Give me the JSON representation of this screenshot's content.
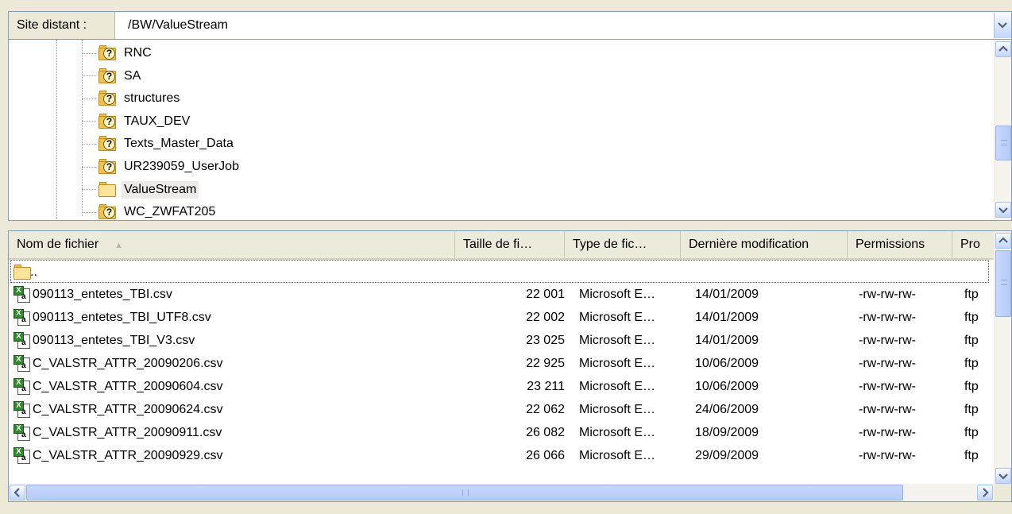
{
  "remote_site": {
    "label": "Site distant :",
    "path": "/BW/ValueStream"
  },
  "tree": {
    "items": [
      {
        "label": "RNC",
        "icon": "folder-unknown-icon",
        "selected": false
      },
      {
        "label": "SA",
        "icon": "folder-unknown-icon",
        "selected": false
      },
      {
        "label": "structures",
        "icon": "folder-unknown-icon",
        "selected": false
      },
      {
        "label": "TAUX_DEV",
        "icon": "folder-unknown-icon",
        "selected": false
      },
      {
        "label": "Texts_Master_Data",
        "icon": "folder-unknown-icon",
        "selected": false
      },
      {
        "label": "UR239059_UserJob",
        "icon": "folder-unknown-icon",
        "selected": false
      },
      {
        "label": "ValueStream",
        "icon": "folder-open-icon",
        "selected": true
      },
      {
        "label": "WC_ZWFAT205",
        "icon": "folder-unknown-icon",
        "selected": false
      }
    ]
  },
  "file_list": {
    "headers": {
      "name": "Nom de fichier",
      "sort_indicator": "▲",
      "size": "Taille de fi…",
      "type": "Type de fic…",
      "modified": "Dernière modification",
      "permissions": "Permissions",
      "owner": "Pro"
    },
    "parent_dir": "..",
    "rows": [
      {
        "name": "090113_entetes_TBI.csv",
        "size": "22 001",
        "type": "Microsoft E…",
        "modified": "14/01/2009",
        "permissions": "-rw-rw-rw-",
        "owner": "ftp"
      },
      {
        "name": "090113_entetes_TBI_UTF8.csv",
        "size": "22 002",
        "type": "Microsoft E…",
        "modified": "14/01/2009",
        "permissions": "-rw-rw-rw-",
        "owner": "ftp"
      },
      {
        "name": "090113_entetes_TBI_V3.csv",
        "size": "23 025",
        "type": "Microsoft E…",
        "modified": "14/01/2009",
        "permissions": "-rw-rw-rw-",
        "owner": "ftp"
      },
      {
        "name": "C_VALSTR_ATTR_20090206.csv",
        "size": "22 925",
        "type": "Microsoft E…",
        "modified": "10/06/2009",
        "permissions": "-rw-rw-rw-",
        "owner": "ftp"
      },
      {
        "name": "C_VALSTR_ATTR_20090604.csv",
        "size": "23 211",
        "type": "Microsoft E…",
        "modified": "10/06/2009",
        "permissions": "-rw-rw-rw-",
        "owner": "ftp"
      },
      {
        "name": "C_VALSTR_ATTR_20090624.csv",
        "size": "22 062",
        "type": "Microsoft E…",
        "modified": "24/06/2009",
        "permissions": "-rw-rw-rw-",
        "owner": "ftp"
      },
      {
        "name": "C_VALSTR_ATTR_20090911.csv",
        "size": "26 082",
        "type": "Microsoft E…",
        "modified": "18/09/2009",
        "permissions": "-rw-rw-rw-",
        "owner": "ftp"
      },
      {
        "name": "C_VALSTR_ATTR_20090929.csv",
        "size": "26 066",
        "type": "Microsoft E…",
        "modified": "29/09/2009",
        "permissions": "-rw-rw-rw-",
        "owner": "ftp"
      }
    ]
  },
  "colors": {
    "accent": "#7f9db9",
    "scroll_button": "#c3d5fd"
  }
}
